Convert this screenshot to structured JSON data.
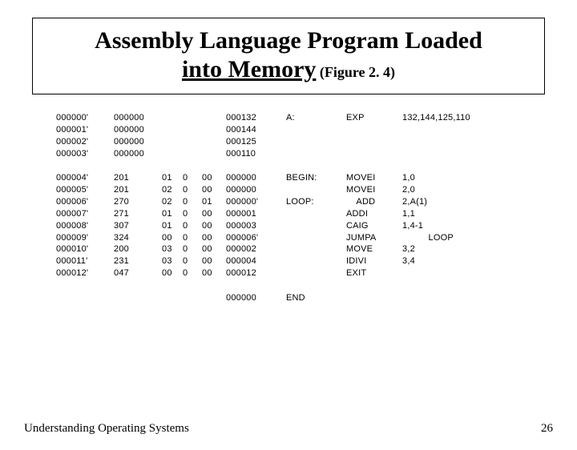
{
  "title": {
    "line1_pre": "Assembly Language Program Loaded",
    "line2_a": "into Memory",
    "line2_b": " (Figure 2. 4)"
  },
  "rows": [
    [
      "000000'",
      "000000",
      "",
      "",
      "",
      "000132",
      "A:",
      "EXP",
      "132,144,125,110"
    ],
    [
      "000001'",
      "000000",
      "",
      "",
      "",
      "000144",
      "",
      "",
      ""
    ],
    [
      "000002'",
      "000000",
      "",
      "",
      "",
      "000125",
      "",
      "",
      ""
    ],
    [
      "000003'",
      "000000",
      "",
      "",
      "",
      "000110",
      "",
      "",
      ""
    ],
    [
      "SPACER"
    ],
    [
      "000004'",
      "201",
      "01",
      "0",
      "00",
      "000000",
      "BEGIN:",
      "MOVEI",
      "1,0"
    ],
    [
      "000005'",
      "201",
      "02",
      "0",
      "00",
      "000000",
      "",
      "MOVEI",
      "2,0"
    ],
    [
      "000006'",
      "270",
      "02",
      "0",
      "01",
      "000000'",
      "LOOP:",
      "    ADD",
      "2,A(1)"
    ],
    [
      "000007'",
      "271",
      "01",
      "0",
      "00",
      "000001",
      "",
      "ADDI",
      "1,1"
    ],
    [
      "000008'",
      "307",
      "01",
      "0",
      "00",
      "000003",
      "",
      "CAIG",
      "1,4-1"
    ],
    [
      "000009'",
      "324",
      "00",
      "0",
      "00",
      "000006'",
      "",
      "JUMPA",
      "          LOOP"
    ],
    [
      "000010'",
      "200",
      "03",
      "0",
      "00",
      "000002",
      "",
      "MOVE",
      "3,2"
    ],
    [
      "000011'",
      "231",
      "03",
      "0",
      "00",
      "000004",
      "",
      "IDIVI",
      "3,4"
    ],
    [
      "000012'",
      "047",
      "00",
      "0",
      "00",
      "000012",
      "",
      "EXIT",
      ""
    ],
    [
      "SPACER"
    ],
    [
      "",
      "",
      "",
      "",
      "",
      "000000",
      "END",
      "",
      ""
    ]
  ],
  "footer": {
    "left": "Understanding Operating Systems",
    "right": "26"
  }
}
